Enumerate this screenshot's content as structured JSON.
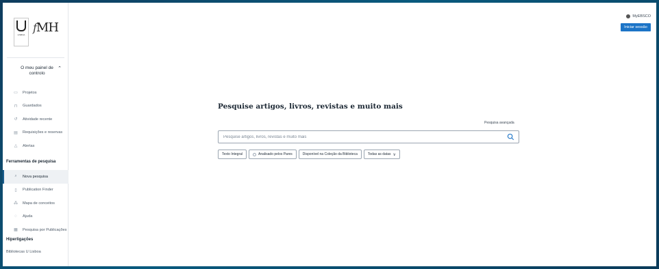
{
  "header": {
    "account_label": "MyEBSCO",
    "signin_label": "Iniciar sessão"
  },
  "sidebar": {
    "logo": {
      "u_text": "LISBOA",
      "fmh_text": "MH",
      "fmh_f": "f"
    },
    "dashboard_toggle": "O meu painel de controlo",
    "dashboard_items": [
      {
        "label": "Projetos",
        "icon": "folder-icon"
      },
      {
        "label": "Guardados",
        "icon": "bookmark-icon"
      },
      {
        "label": "Atividade recente",
        "icon": "history-icon"
      },
      {
        "label": "Requisições e reservas",
        "icon": "document-icon"
      },
      {
        "label": "Alertas",
        "icon": "bell-icon"
      }
    ],
    "tools_title": "Ferramentas de pesquisa",
    "tools_items": [
      {
        "label": "Nova pesquisa",
        "icon": "search-icon"
      },
      {
        "label": "Publication Finder",
        "icon": "publication-icon"
      },
      {
        "label": "Mapa de conceitos",
        "icon": "concept-map-icon"
      },
      {
        "label": "Ajuda",
        "icon": "help-icon"
      },
      {
        "label": "Pesquisa por Publicações",
        "icon": "publications-list-icon"
      }
    ],
    "links_title": "Hiperligações",
    "links_items": [
      {
        "label": "Bibliotecas U Lisboa"
      }
    ]
  },
  "main": {
    "title": "Pesquise artigos, livros, revistas e muito mais",
    "advanced_link": "Pesquisa avançada",
    "search": {
      "placeholder": "Pesquise artigos, livros, revistas e muito mais",
      "value": ""
    },
    "filters": {
      "full_text": "Texto Integral",
      "peer_reviewed": "Analisado pelos Pares",
      "library_collection": "Disponível na Coleção da Biblioteca",
      "dates": "Todas as datas"
    }
  },
  "colors": {
    "accent": "#1c74c7",
    "active_marker": "#1c5f8f",
    "background_frame": "#0f3d5e"
  }
}
